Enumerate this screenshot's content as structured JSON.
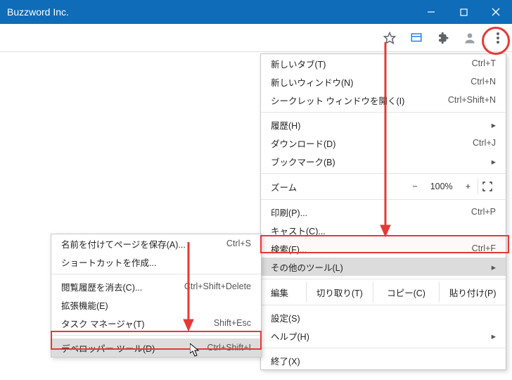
{
  "window": {
    "title": "Buzzword Inc."
  },
  "mainMenu": {
    "newTab": {
      "label": "新しいタブ(T)",
      "shortcut": "Ctrl+T"
    },
    "newWindow": {
      "label": "新しいウィンドウ(N)",
      "shortcut": "Ctrl+N"
    },
    "incognito": {
      "label": "シークレット ウィンドウを開く(I)",
      "shortcut": "Ctrl+Shift+N"
    },
    "history": {
      "label": "履歴(H)"
    },
    "downloads": {
      "label": "ダウンロード(D)",
      "shortcut": "Ctrl+J"
    },
    "bookmarks": {
      "label": "ブックマーク(B)"
    },
    "zoom": {
      "label": "ズーム",
      "minus": "−",
      "value": "100%",
      "plus": "+"
    },
    "print": {
      "label": "印刷(P)...",
      "shortcut": "Ctrl+P"
    },
    "cast": {
      "label": "キャスト(C)..."
    },
    "find": {
      "label": "検索(F)...",
      "shortcut": "Ctrl+F"
    },
    "moreTools": {
      "label": "その他のツール(L)"
    },
    "edit": {
      "label": "編集",
      "cut": "切り取り(T)",
      "copy": "コピー(C)",
      "paste": "貼り付け(P)"
    },
    "settings": {
      "label": "設定(S)"
    },
    "help": {
      "label": "ヘルプ(H)"
    },
    "exit": {
      "label": "終了(X)"
    }
  },
  "subMenu": {
    "savePageAs": {
      "label": "名前を付けてページを保存(A)...",
      "shortcut": "Ctrl+S"
    },
    "createShortcut": {
      "label": "ショートカットを作成..."
    },
    "clearBrowsing": {
      "label": "閲覧履歴を消去(C)...",
      "shortcut": "Ctrl+Shift+Delete"
    },
    "extensions": {
      "label": "拡張機能(E)"
    },
    "taskManager": {
      "label": "タスク マネージャ(T)",
      "shortcut": "Shift+Esc"
    },
    "devTools": {
      "label": "デベロッパー ツール(D)",
      "shortcut": "Ctrl+Shift+I"
    }
  }
}
